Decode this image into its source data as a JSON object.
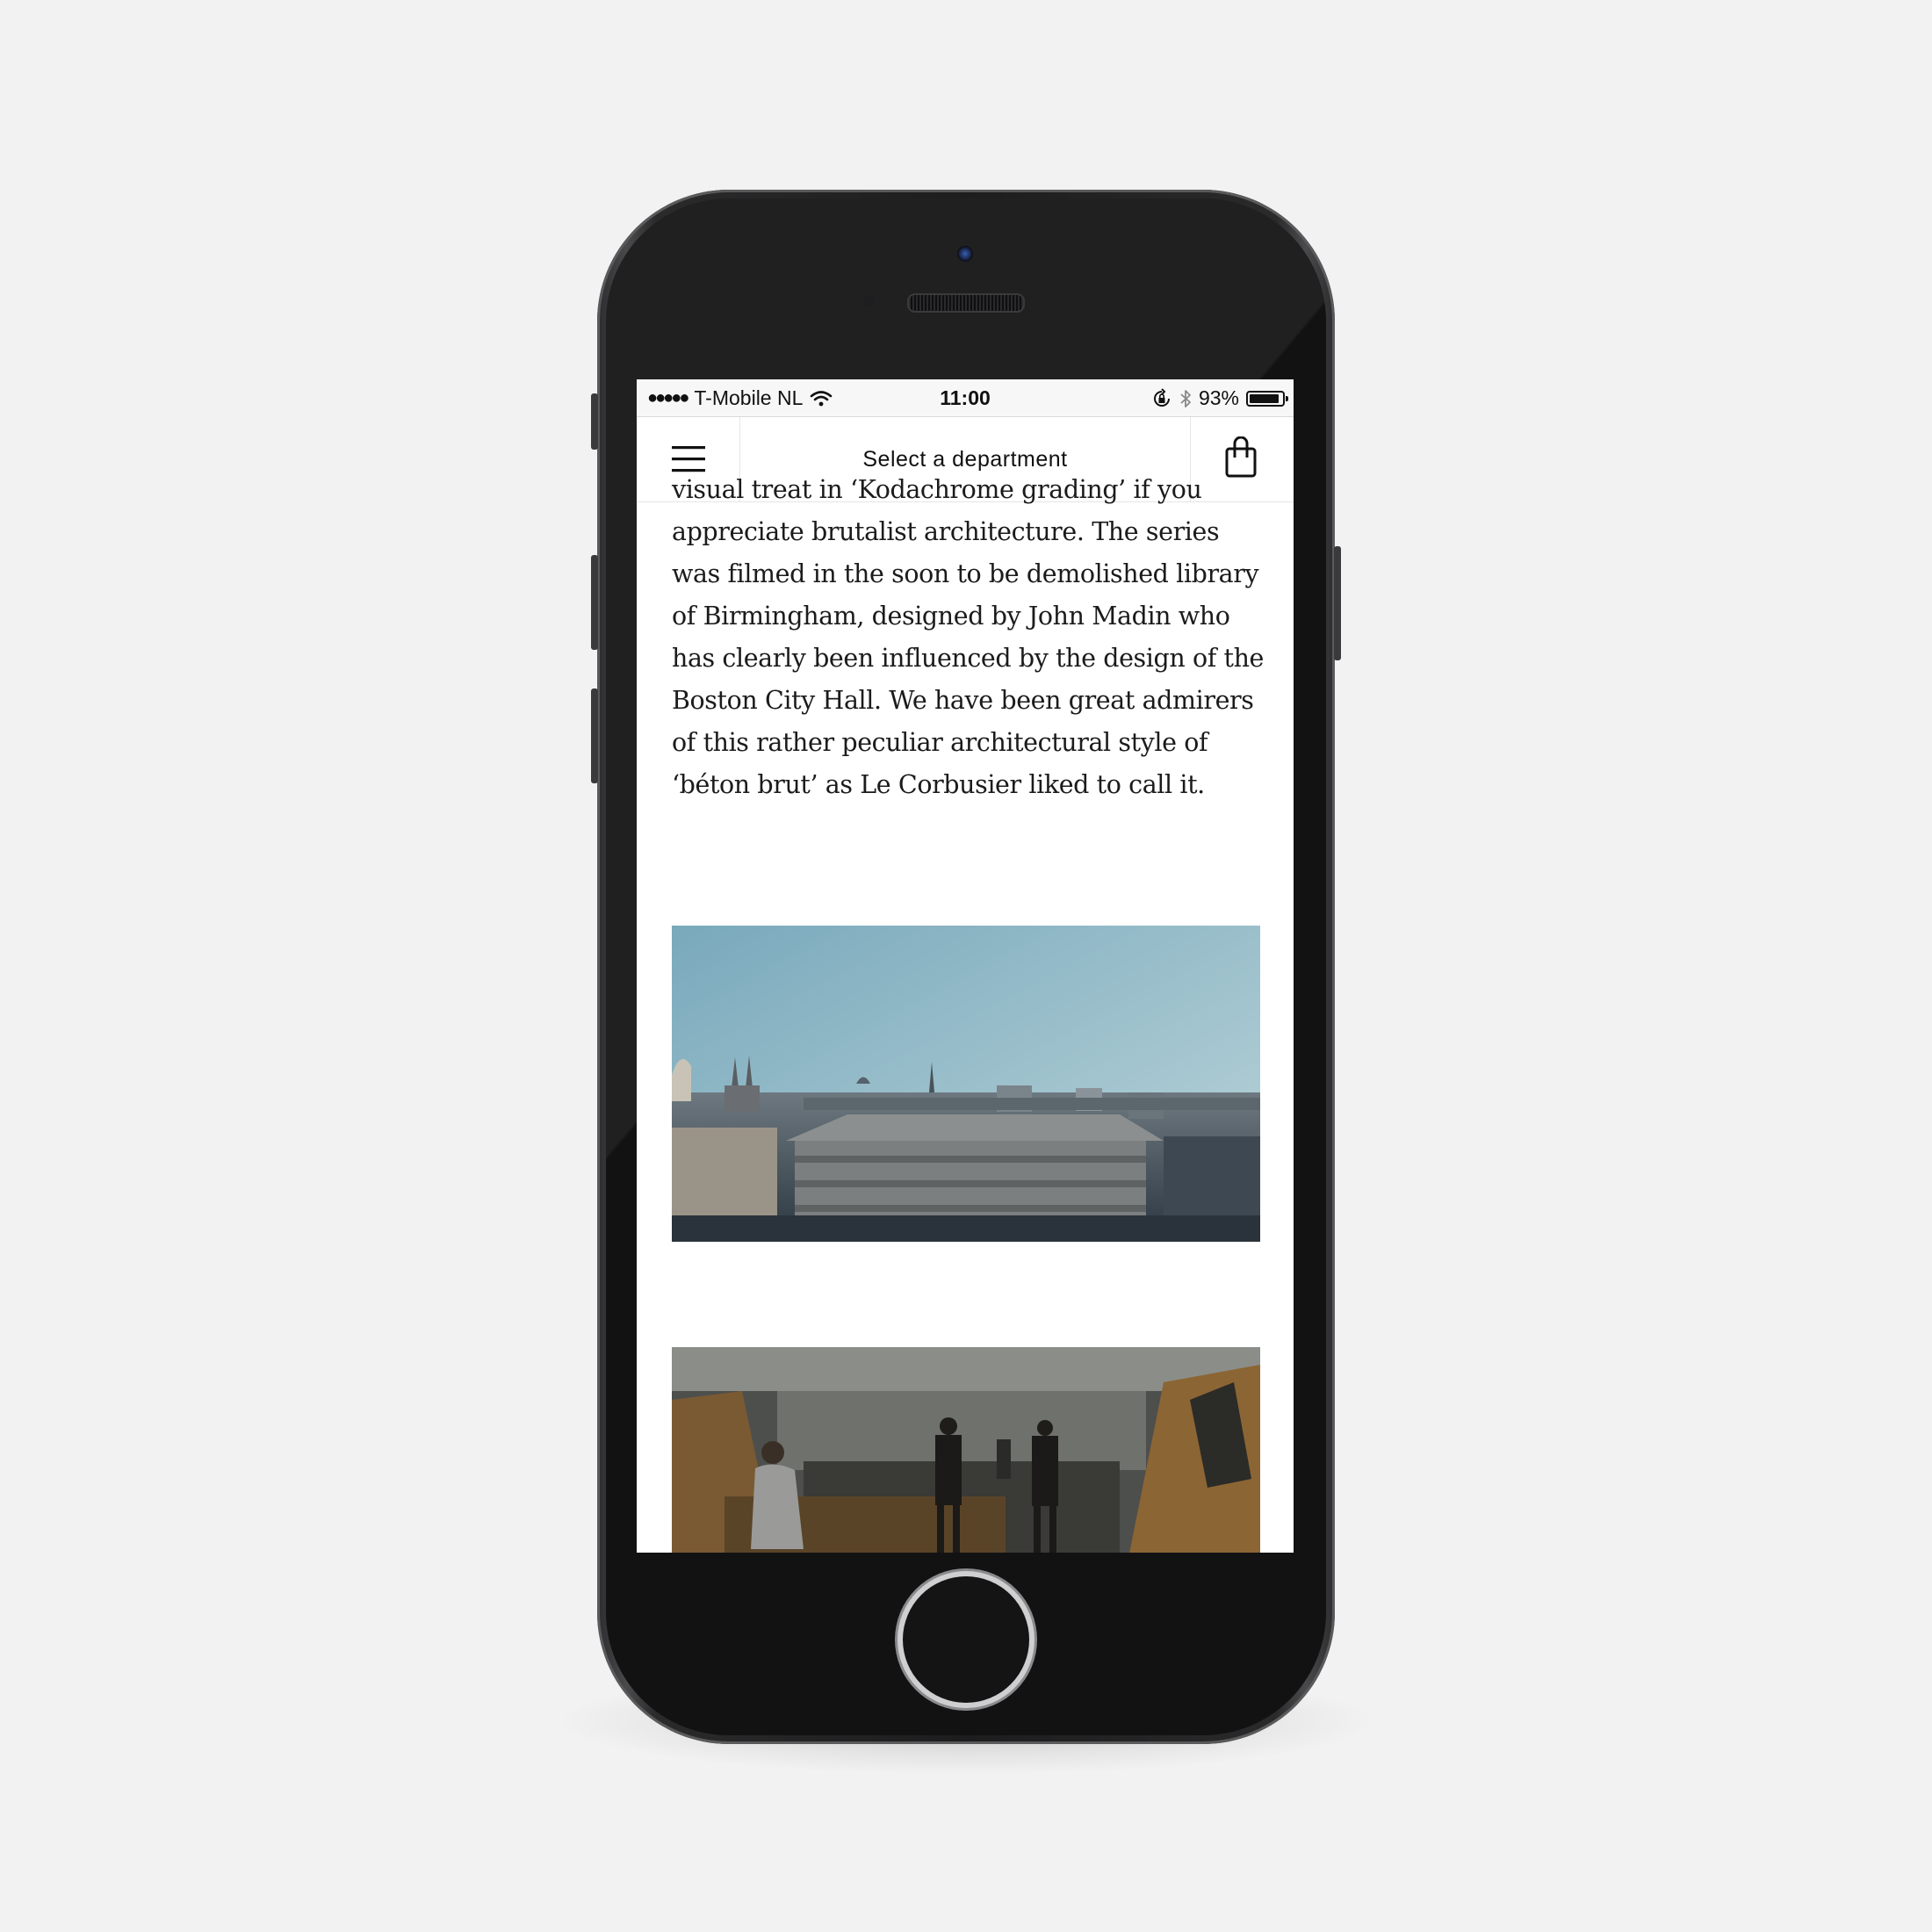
{
  "status_bar": {
    "signal": "●●●●●",
    "carrier": "T-Mobile NL",
    "time": "11:00",
    "battery_label": "93%",
    "battery_level": 0.93
  },
  "nav": {
    "menu_icon": "hamburger-menu-icon",
    "title": "Select a department",
    "bag_icon": "shopping-bag-icon"
  },
  "article": {
    "partial_line": "visual treat in ‘Kodachrome grading’ if",
    "text": "you appreciate brutalist architecture. The series was filmed in the soon to be demolished library of Birmingham, designed by John Madin who has clearly been influenced by the design of the Boston City Hall. We have been great admirers of this rather peculiar architectural style of ‘béton brut’ as Le Corbusier liked to call it."
  },
  "colors": {
    "sky_top": "#7fb0c2",
    "sky_bottom": "#b9d3d9",
    "text": "#1b1b1b",
    "background": "#f2f2f2"
  }
}
